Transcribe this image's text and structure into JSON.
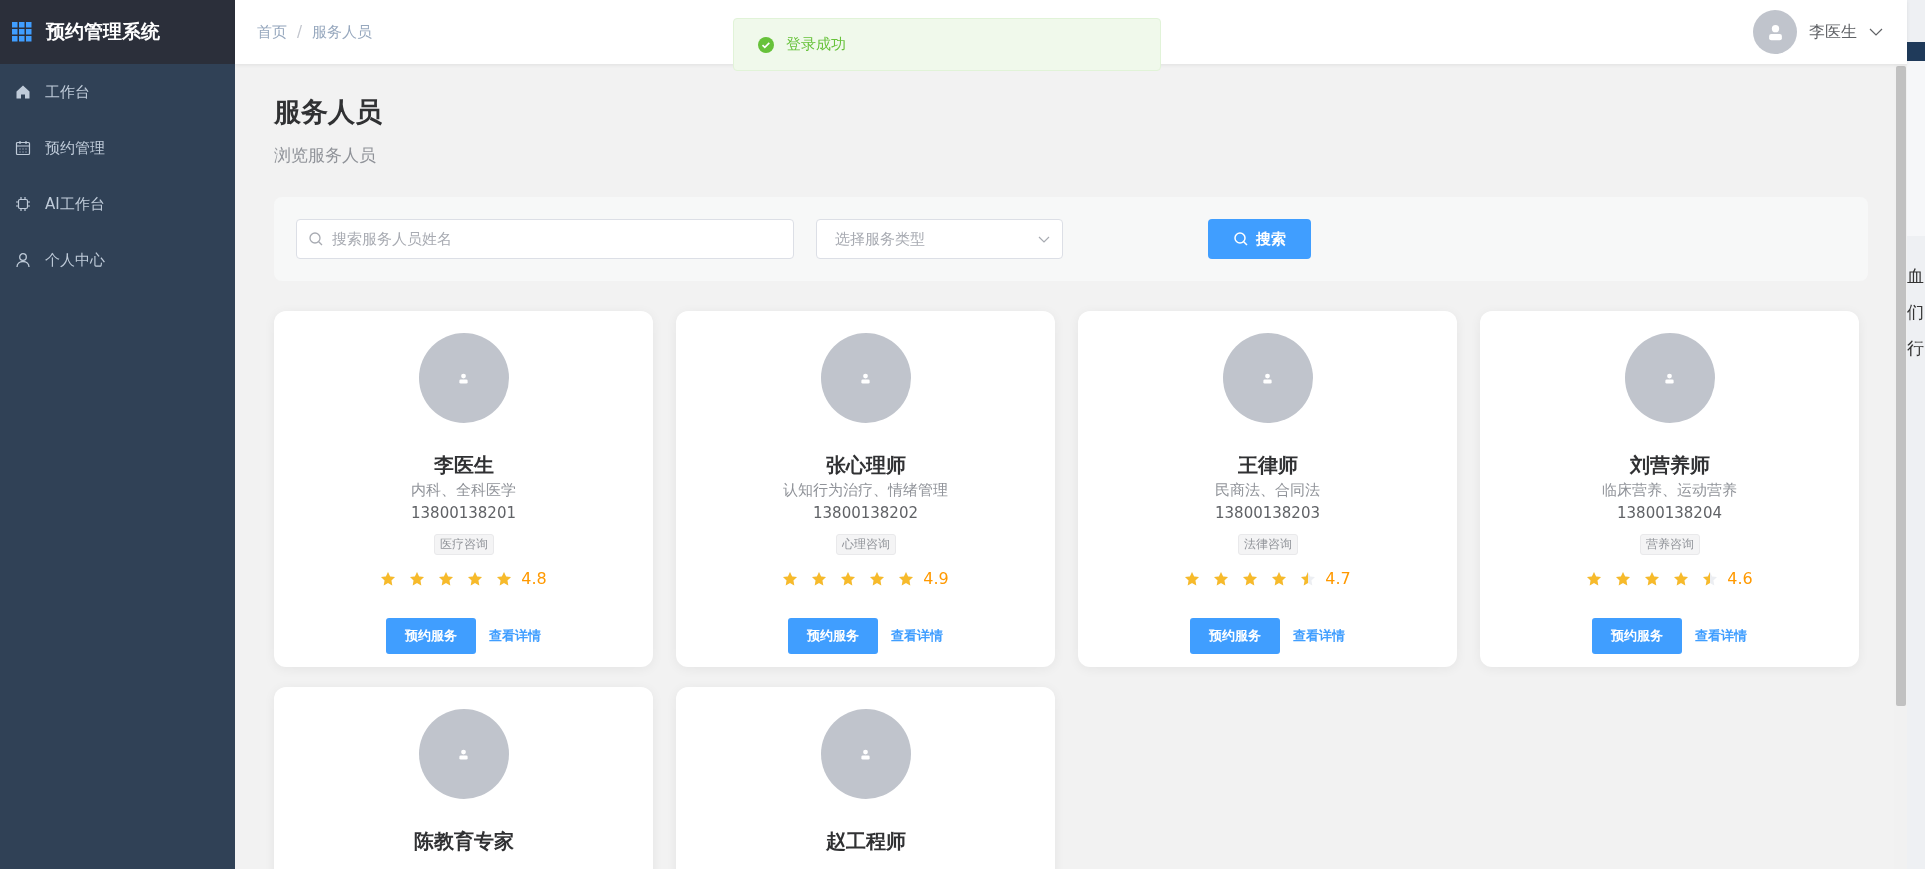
{
  "sidebar": {
    "title": "预约管理系统",
    "items": [
      {
        "label": "工作台",
        "kind": "home",
        "selected": false
      },
      {
        "label": "预约管理",
        "kind": "calendar",
        "selected": false
      },
      {
        "label": "AI工作台",
        "kind": "chip",
        "selected": false
      },
      {
        "label": "个人中心",
        "kind": "user",
        "selected": false
      }
    ]
  },
  "header": {
    "breadcrumb": [
      "首页",
      "服务人员"
    ],
    "separator": "/",
    "user": "李医生"
  },
  "toast": {
    "text": "登录成功"
  },
  "page": {
    "title": "服务人员",
    "subtitle": "浏览服务人员"
  },
  "filters": {
    "search": {
      "placeholder": "搜索服务人员姓名"
    },
    "type_select": {
      "placeholder": "选择服务类型"
    },
    "button": "搜索"
  },
  "staff": [
    {
      "name": "李医生",
      "specialty": "内科、全科医学",
      "phone": "13800138201",
      "tag": "医疗咨询",
      "stars": 5,
      "rating": "4.8",
      "book": "预约服务",
      "details": "查看详情"
    },
    {
      "name": "张心理师",
      "specialty": "认知行为治疗、情绪管理",
      "phone": "13800138202",
      "tag": "心理咨询",
      "stars": 5,
      "rating": "4.9",
      "book": "预约服务",
      "details": "查看详情"
    },
    {
      "name": "王律师",
      "specialty": "民商法、合同法",
      "phone": "13800138203",
      "tag": "法律咨询",
      "stars": 4.5,
      "rating": "4.7",
      "book": "预约服务",
      "details": "查看详情"
    },
    {
      "name": "刘营养师",
      "specialty": "临床营养、运动营养",
      "phone": "13800138204",
      "tag": "营养咨询",
      "stars": 4.5,
      "rating": "4.6",
      "book": "预约服务",
      "details": "查看详情"
    },
    {
      "name": "陈教育专家"
    },
    {
      "name": "赵工程师"
    }
  ],
  "background_window": {
    "lines": [
      "血",
      "们",
      "行"
    ]
  }
}
